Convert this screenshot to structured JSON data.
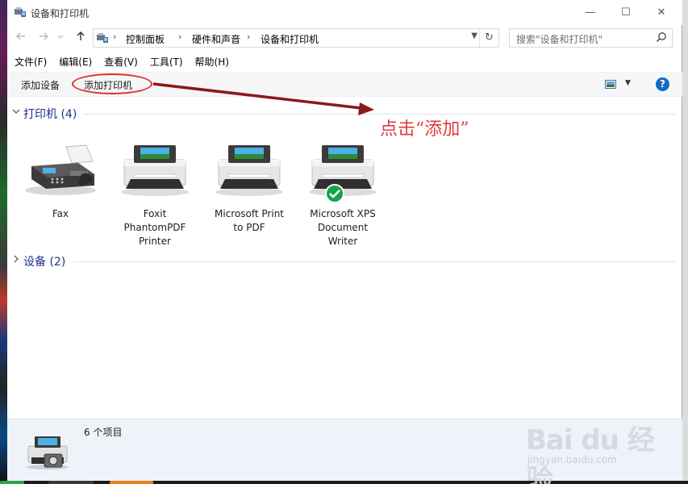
{
  "window": {
    "title": "设备和打印机",
    "controls": {
      "minimize": "—",
      "maximize": "☐",
      "close": "✕"
    }
  },
  "navigation": {
    "breadcrumbs": [
      "控制面板",
      "硬件和声音",
      "设备和打印机"
    ],
    "search_placeholder": "搜索\"设备和打印机\""
  },
  "menubar": {
    "items": [
      "文件(F)",
      "编辑(E)",
      "查看(V)",
      "工具(T)",
      "帮助(H)"
    ]
  },
  "commandbar": {
    "add_device": "添加设备",
    "add_printer": "添加打印机",
    "help": "?"
  },
  "groups": {
    "printers": {
      "label": "打印机 (4)",
      "expanded": true,
      "items": [
        {
          "name_lines": [
            "Fax"
          ],
          "icon": "fax-icon",
          "default": false
        },
        {
          "name_lines": [
            "Foxit",
            "PhantomPDF",
            "Printer"
          ],
          "icon": "printer-icon",
          "default": false
        },
        {
          "name_lines": [
            "Microsoft Print",
            "to PDF"
          ],
          "icon": "printer-icon",
          "default": false
        },
        {
          "name_lines": [
            "Microsoft XPS",
            "Document",
            "Writer"
          ],
          "icon": "printer-icon",
          "default": true
        }
      ]
    },
    "devices": {
      "label": "设备 (2)",
      "expanded": false
    }
  },
  "annotation": {
    "text": "点击“添加”",
    "color": "#e03c3c"
  },
  "details": {
    "count": "6 个项目"
  },
  "watermark": {
    "main": "Bai du 经验",
    "sub": "jingyan.baidu.com"
  }
}
